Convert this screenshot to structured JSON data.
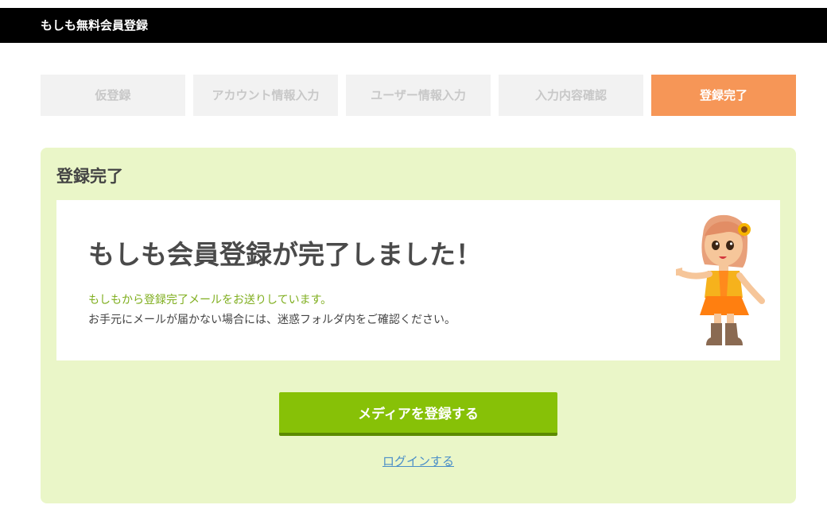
{
  "header": {
    "title": "もしも無料会員登録"
  },
  "steps": [
    {
      "label": "仮登録",
      "active": false
    },
    {
      "label": "アカウント情報入力",
      "active": false
    },
    {
      "label": "ユーザー情報入力",
      "active": false
    },
    {
      "label": "入力内容確認",
      "active": false
    },
    {
      "label": "登録完了",
      "active": true
    }
  ],
  "panel": {
    "title": "登録完了",
    "headline": "もしも会員登録が完了しました！",
    "message_green": "もしもから登録完了メールをお送りしています。",
    "message_gray": "お手元にメールが届かない場合には、迷惑フォルダ内をご確認ください。",
    "register_button_label": "メディアを登録する",
    "login_link_label": "ログインする"
  },
  "colors": {
    "header_bg": "#000000",
    "step_inactive_bg": "#f2f2f2",
    "step_active_bg": "#f69657",
    "panel_bg": "#eaf6c8",
    "button_bg": "#87c107",
    "link": "#4a8ec8"
  },
  "icons": {
    "mascot": "mascot-girl-illustration"
  }
}
